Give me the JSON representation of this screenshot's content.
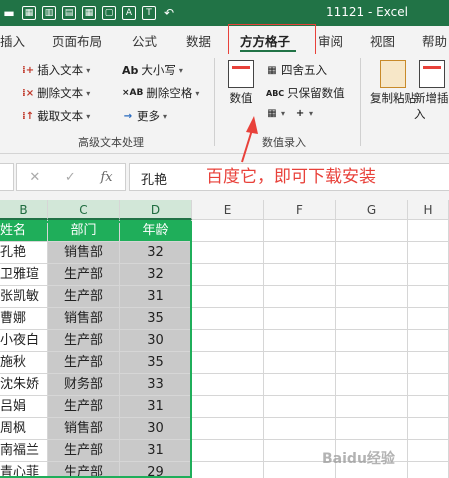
{
  "window": {
    "title": "11121 - Excel",
    "qat_icons": [
      "save-icon",
      "table-icon",
      "chart-icon",
      "calculator-icon",
      "table-icon",
      "file-icon",
      "font-a-icon",
      "text-icon",
      "undo-icon"
    ]
  },
  "tabs": [
    {
      "label": "插入",
      "active": false
    },
    {
      "label": "页面布局",
      "active": false
    },
    {
      "label": "公式",
      "active": false
    },
    {
      "label": "数据",
      "active": false
    },
    {
      "label": "方方格子",
      "active": true
    },
    {
      "label": "审阅",
      "active": false
    },
    {
      "label": "视图",
      "active": false
    },
    {
      "label": "帮助",
      "active": false
    }
  ],
  "ribbon": {
    "text_group": {
      "insert_text": "插入文本",
      "delete_text": "删除文本",
      "cut_text": "截取文本",
      "case": "大小写",
      "delete_space": "删除空格",
      "more": "更多",
      "label": "高级文本处理"
    },
    "number_group": {
      "numeric": "数值",
      "round": "四舍五入",
      "keep_value": "只保留数值",
      "label": "数值录入"
    },
    "paste_group": {
      "copy_paste": "复制粘贴",
      "new_insert": "新增插入"
    }
  },
  "formula_bar": {
    "value": "孔艳"
  },
  "annotation": "百度它，即可下载安装",
  "columns": [
    "B",
    "C",
    "D",
    "E",
    "F",
    "G",
    "H"
  ],
  "table": {
    "headers": [
      "姓名",
      "部门",
      "年龄"
    ],
    "rows": [
      [
        "孔艳",
        "销售部",
        "32"
      ],
      [
        "卫雅瑄",
        "生产部",
        "32"
      ],
      [
        "张凯敏",
        "生产部",
        "31"
      ],
      [
        "曹娜",
        "销售部",
        "35"
      ],
      [
        "小夜白",
        "生产部",
        "30"
      ],
      [
        "施秋",
        "生产部",
        "35"
      ],
      [
        "沈朱娇",
        "财务部",
        "33"
      ],
      [
        "吕娟",
        "生产部",
        "31"
      ],
      [
        "周枫",
        "销售部",
        "30"
      ],
      [
        "南福兰",
        "生产部",
        "31"
      ],
      [
        "青心菲",
        "生产部",
        "29"
      ]
    ]
  },
  "watermark": "Baidu经验"
}
